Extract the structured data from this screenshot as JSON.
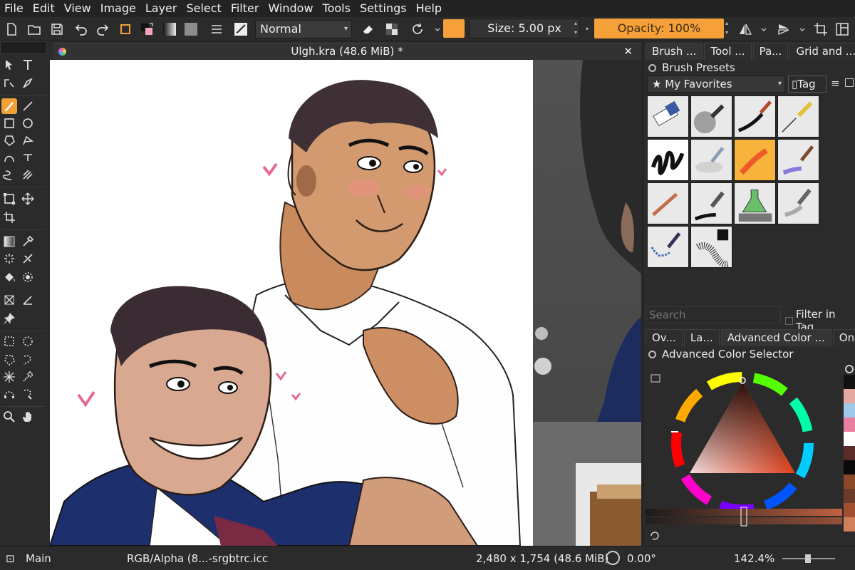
{
  "menu": [
    "File",
    "Edit",
    "View",
    "Image",
    "Layer",
    "Select",
    "Filter",
    "Window",
    "Tools",
    "Settings",
    "Help"
  ],
  "toolbar": {
    "blend_mode": "Normal",
    "size_label": "Size: 5.00 px",
    "opacity_label": "Opacity: 100%",
    "brush_color": "#f5a038"
  },
  "document": {
    "tab_title": "Ulgh.kra (48.6 MiB) *"
  },
  "docker": {
    "tabs": [
      "Brush ...",
      "Tool ...",
      "Pa...",
      "Grid and ..."
    ],
    "brush_presets_title": "Brush Presets",
    "favorites": "My Favorites",
    "tag_label": "Tag",
    "search_placeholder": "Search",
    "filter_in_tag": "Filter in Tag",
    "lower_tabs": [
      "Ov...",
      "La...",
      "Advanced Color ...",
      "Oni..."
    ],
    "color_selector_title": "Advanced Color Selector"
  },
  "status": {
    "layer": "Main",
    "color_profile": "RGB/Alpha (8...-srgbtrc.icc",
    "dimensions": "2,480 x 1,754 (48.6 MiB)",
    "rotation": "0.00°",
    "zoom": "142.4%"
  },
  "colors": {
    "accent": "#f5a038",
    "panel": "#2b2b2b"
  }
}
